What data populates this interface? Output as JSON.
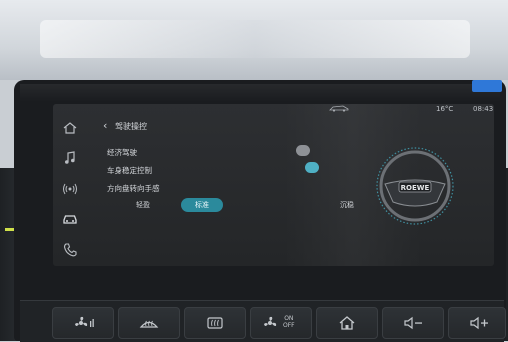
{
  "status_bar": {
    "temperature": "16°C",
    "time": "08:43",
    "car_icon": "car-top-icon"
  },
  "sidebar": {
    "items": [
      {
        "icon": "home-icon"
      },
      {
        "icon": "music-note-icon"
      },
      {
        "icon": "signal-icon"
      },
      {
        "icon": "car-icon"
      },
      {
        "icon": "phone-icon"
      }
    ]
  },
  "header": {
    "back_icon": "chevron-left-icon",
    "title": "驾驶操控"
  },
  "settings": {
    "economy_drive_label": "经济驾驶",
    "economy_drive_on": false,
    "stability_control_label": "车身稳定控制",
    "stability_control_on": true,
    "steering_feel_label": "方向盘转向手感",
    "steering_options": [
      "轻盈",
      "标准",
      "沉稳"
    ],
    "steering_selected": "标准"
  },
  "steering_wheel": {
    "brand": "ROEWE"
  },
  "hard_buttons": [
    {
      "name": "fan-button",
      "icon": "fan-icon"
    },
    {
      "name": "front-defrost-button",
      "icon": "front-defrost-icon"
    },
    {
      "name": "rear-defrost-button",
      "icon": "rear-defrost-icon"
    },
    {
      "name": "fan-onoff-button",
      "icon": "fan-icon",
      "label_top": "ON",
      "label_bottom": "OFF"
    },
    {
      "name": "home-button",
      "icon": "home-icon"
    },
    {
      "name": "volume-down-button",
      "icon": "volume-down-icon"
    },
    {
      "name": "volume-up-button",
      "icon": "volume-up-icon"
    }
  ],
  "colors": {
    "accent": "#4fb0c4",
    "active_segment": "#2b8a9c"
  }
}
